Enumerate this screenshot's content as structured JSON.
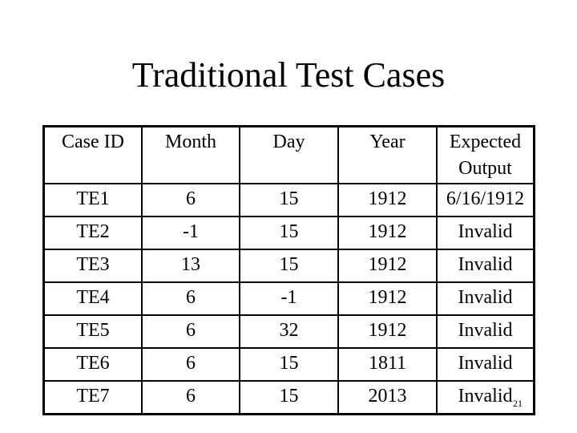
{
  "slide": {
    "title": "Traditional Test Cases",
    "page_number": "21"
  },
  "table": {
    "headers": [
      "Case ID",
      "Month",
      "Day",
      "Year",
      "Expected Output"
    ],
    "rows": [
      [
        "TE1",
        "6",
        "15",
        "1912",
        "6/16/1912"
      ],
      [
        "TE2",
        "-1",
        "15",
        "1912",
        "Invalid"
      ],
      [
        "TE3",
        "13",
        "15",
        "1912",
        "Invalid"
      ],
      [
        "TE4",
        "6",
        "-1",
        "1912",
        "Invalid"
      ],
      [
        "TE5",
        "6",
        "32",
        "1912",
        "Invalid"
      ],
      [
        "TE6",
        "6",
        "15",
        "1811",
        "Invalid"
      ],
      [
        "TE7",
        "6",
        "15",
        "2013",
        "Invalid"
      ]
    ]
  }
}
